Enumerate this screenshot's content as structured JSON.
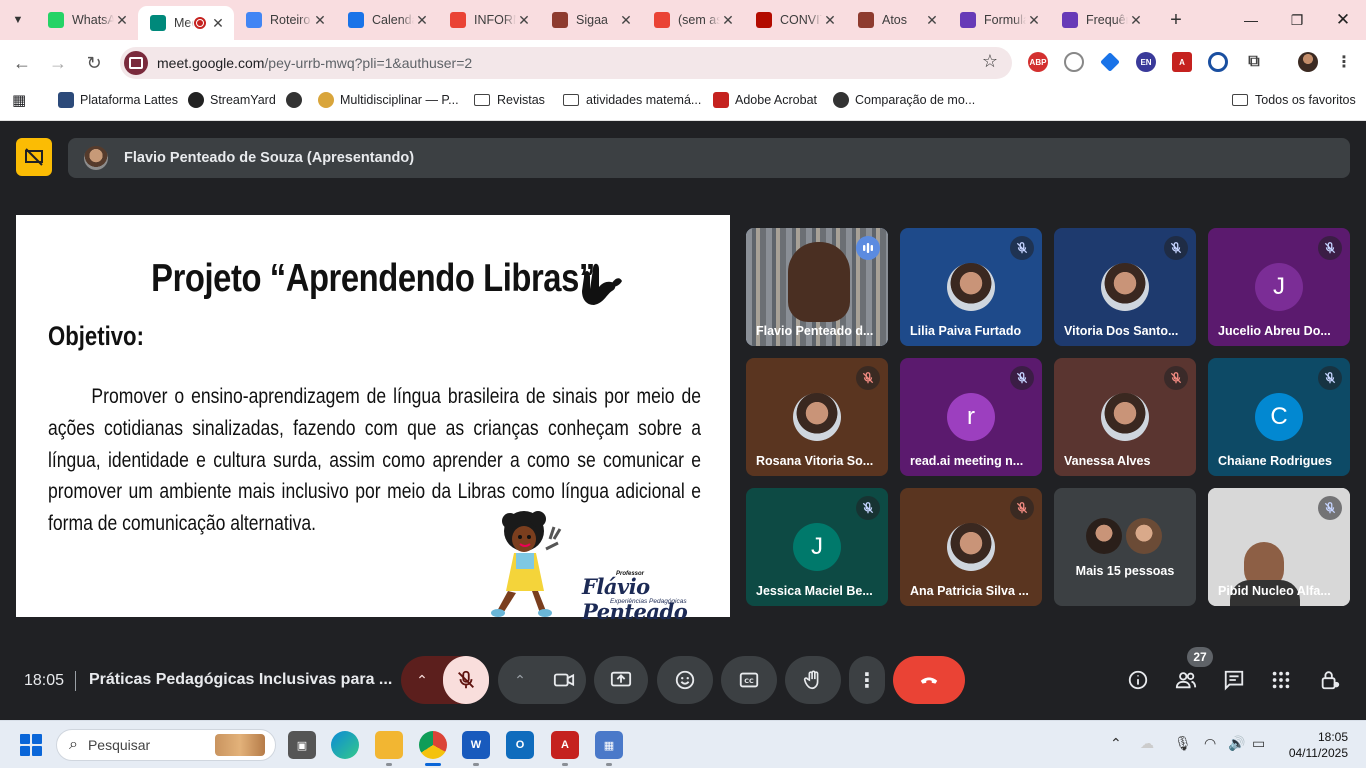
{
  "browser": {
    "tabs": [
      {
        "title": "WhatsApp",
        "icon": "whatsapp-icon",
        "color": "#25d366"
      },
      {
        "title": "Meet",
        "icon": "google-meet-icon",
        "color": "#00897b",
        "active": true
      },
      {
        "title": "Roteiro",
        "icon": "google-docs-icon",
        "color": "#4285f4"
      },
      {
        "title": "Calendário",
        "icon": "google-calendar-icon",
        "color": "#1a73e8"
      },
      {
        "title": "INFORMAÇÕES",
        "icon": "gmail-icon",
        "color": "#ea4335"
      },
      {
        "title": "Sigaa",
        "icon": "sigaa-icon",
        "color": "#8e3b2f"
      },
      {
        "title": "(sem assunto)",
        "icon": "gmail-icon",
        "color": "#ea4335"
      },
      {
        "title": "CONVITE",
        "icon": "pdf-icon",
        "color": "#b30b00"
      },
      {
        "title": "Atos",
        "icon": "atos-icon",
        "color": "#8e3b2f"
      },
      {
        "title": "Formulário",
        "icon": "google-forms-icon",
        "color": "#673ab7"
      },
      {
        "title": "Frequência",
        "icon": "google-forms-icon",
        "color": "#673ab7"
      }
    ],
    "url_host": "meet.google.com",
    "url_path": "/pey-urrb-mwq?pli=1&authuser=2",
    "bookmarks": [
      {
        "label": "Plataforma Lattes"
      },
      {
        "label": "StreamYard"
      },
      {
        "label": ""
      },
      {
        "label": "Multidisciplinar — P..."
      },
      {
        "label": "Revistas"
      },
      {
        "label": "atividades matemá..."
      },
      {
        "label": "Adobe Acrobat"
      },
      {
        "label": "Comparação de mo..."
      }
    ],
    "all_bookmarks": "Todos os favoritos"
  },
  "meet": {
    "presenter_label": "Flavio Penteado de Souza (Apresentando)",
    "slide": {
      "title": "Projeto “Aprendendo Libras”",
      "objective_heading": "Objetivo:",
      "body": "Promover o ensino-aprendizagem de língua brasileira de sinais por meio de ações cotidianas sinalizadas, fazendo com que as crianças conheçam sobre a língua, identidade e cultura surda, assim como aprender a como se comunicar e promover um ambiente mais inclusivo por meio da Libras como língua adicional e forma de comunicação alternativa.",
      "brand_small": "Professor",
      "brand": "Flávio Penteado",
      "brand_sub": "Experiências Pedagógicas"
    },
    "participants": [
      {
        "name": "Flavio Penteado d...",
        "kind": "video",
        "bg": "#5a6470",
        "mic": "speaking",
        "selected": true
      },
      {
        "name": "Lilia Paiva Furtado",
        "kind": "photo",
        "bg": "#1e4a8a",
        "mic": "muted"
      },
      {
        "name": "Vitoria Dos Santo...",
        "kind": "photo",
        "bg": "#1e3a6e",
        "mic": "muted"
      },
      {
        "name": "Jucelio Abreu Do...",
        "kind": "letter",
        "letter": "J",
        "bg": "#5b1a6e",
        "avatar": "#7b2d96",
        "mic": "muted"
      },
      {
        "name": "Rosana Vitoria So...",
        "kind": "photo",
        "bg": "#5a3520",
        "mic": "muted-red"
      },
      {
        "name": "read.ai meeting n...",
        "kind": "letter",
        "letter": "r",
        "bg": "#5b1a6e",
        "avatar": "#9c3fbf",
        "mic": "muted"
      },
      {
        "name": "Vanessa Alves",
        "kind": "photo",
        "bg": "#5a3530",
        "mic": "muted-red"
      },
      {
        "name": "Chaiane Rodrigues",
        "kind": "letter",
        "letter": "C",
        "bg": "#0d4a66",
        "avatar": "#0288d1",
        "mic": "muted"
      },
      {
        "name": "Jessica Maciel Be...",
        "kind": "letter",
        "letter": "J",
        "bg": "#0d4a44",
        "avatar": "#00796b",
        "mic": "muted"
      },
      {
        "name": "Ana Patricia Silva ...",
        "kind": "photo",
        "bg": "#5a3520",
        "mic": "muted-red"
      },
      {
        "name": "Mais 15 pessoas",
        "kind": "more",
        "bg": "#3c4043"
      },
      {
        "name": "Pibid Nucleo Alfa...",
        "kind": "video2",
        "bg": "#cfcfcf",
        "mic": "muted"
      }
    ],
    "clock": "18:05",
    "meeting_title": "Práticas Pedagógicas Inclusivas para ...",
    "people_count": "27",
    "accent_red": "#ea4335",
    "mic_off_bg": "#f9dedc"
  },
  "taskbar": {
    "search_placeholder": "Pesquisar",
    "time": "18:05",
    "date": "04/11/2025"
  }
}
